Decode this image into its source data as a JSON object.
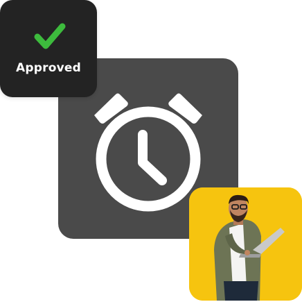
{
  "badge": {
    "label": "Approved",
    "icon": "check-icon",
    "check_color": "#3dbb3d",
    "background": "#232323"
  },
  "alarm": {
    "icon": "alarm-clock-icon",
    "tile_color": "#4a4a4a",
    "glyph_color": "#ffffff"
  },
  "photo": {
    "subject": "man-with-laptop-photo",
    "background": "#f6c40f"
  }
}
